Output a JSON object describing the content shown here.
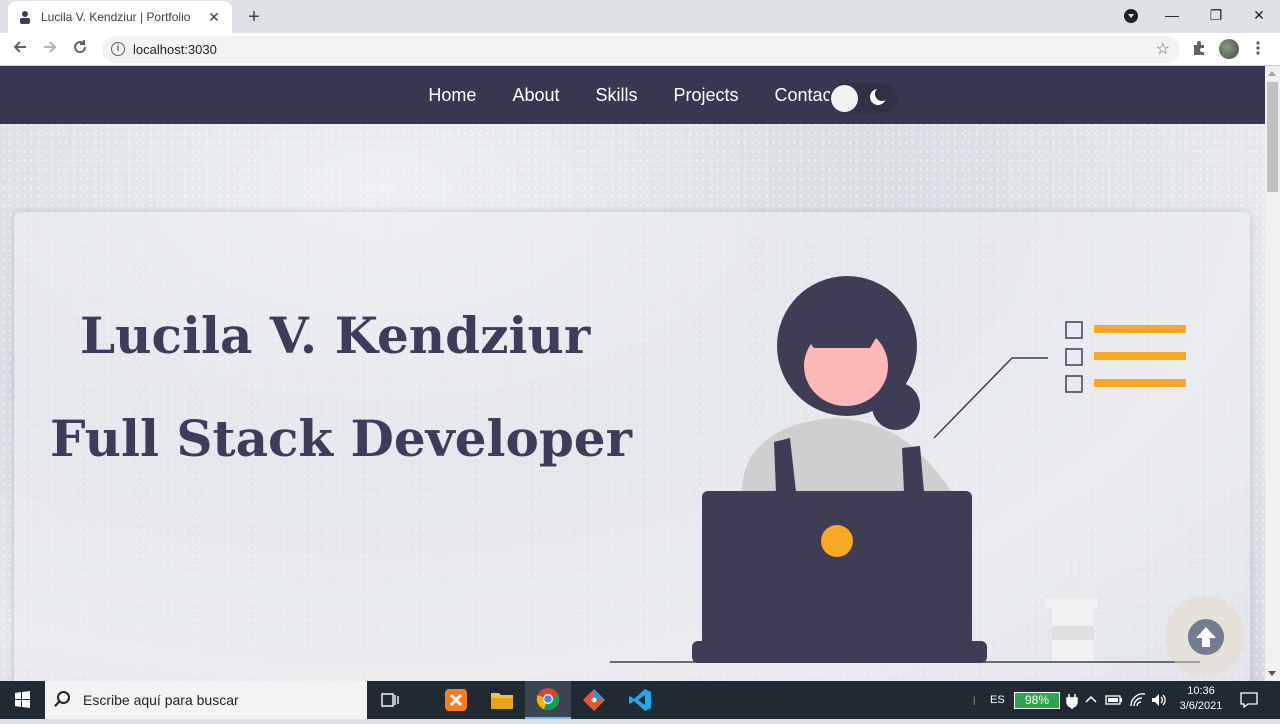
{
  "browser": {
    "tab_title": "Lucila V. Kendziur | Portfolio",
    "tab_close": "✕",
    "new_tab": "+",
    "url": "localhost:3030",
    "window_controls": {
      "minimize": "—",
      "maximize": "❐",
      "close": "✕"
    }
  },
  "navbar": {
    "items": [
      "Home",
      "About",
      "Skills",
      "Projects",
      "Contact"
    ]
  },
  "hero": {
    "name": "Lucila V. Kendziur",
    "role": "Full Stack Developer"
  },
  "colors": {
    "navbar_bg": "#363853",
    "text_dark": "#3c3d5a",
    "accent_orange": "#f9a826",
    "figure_dark": "#3f3d56",
    "skin": "#ffb8b8"
  },
  "taskbar": {
    "search_placeholder": "Escribe aquí para buscar",
    "language": "ES",
    "battery": "98%",
    "time": "10:36",
    "date": "3/6/2021"
  }
}
